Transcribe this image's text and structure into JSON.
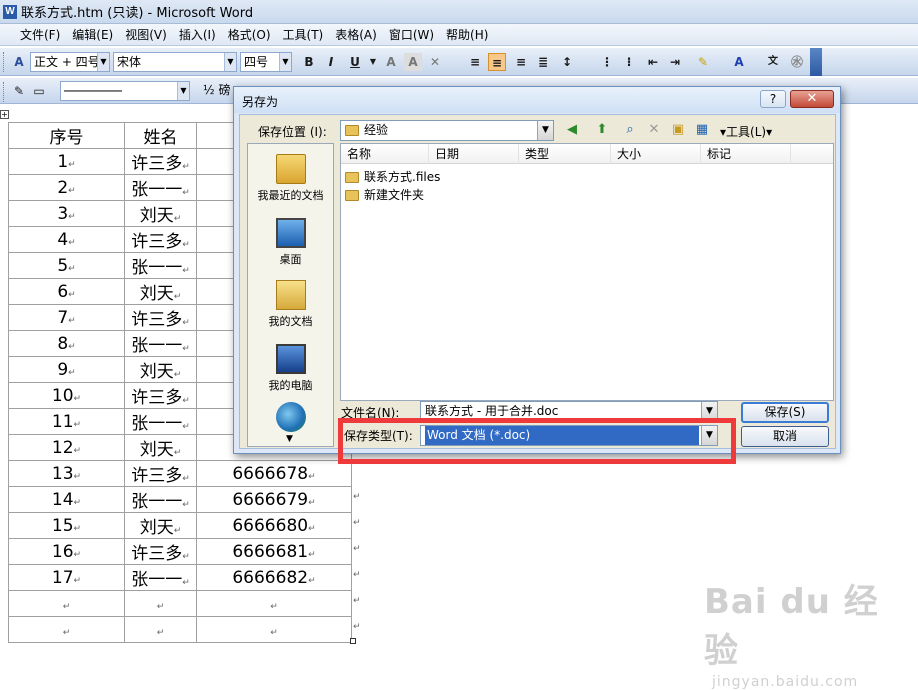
{
  "window": {
    "title": "联系方式.htm (只读) - Microsoft Word",
    "app_icon_letter": "W"
  },
  "menu": [
    "文件(F)",
    "编辑(E)",
    "视图(V)",
    "插入(I)",
    "格式(O)",
    "工具(T)",
    "表格(A)",
    "窗口(W)",
    "帮助(H)"
  ],
  "toolbar": {
    "style_combo": "正文 + 四号",
    "font_combo": "宋体",
    "size_combo": "四号",
    "bold": "B",
    "italic": "I",
    "underline": "U",
    "line_style": "────────",
    "line_weight": "½ 磅"
  },
  "table": {
    "headers": [
      "序号",
      "姓名",
      ""
    ],
    "rows": [
      [
        "1",
        "许三多",
        ""
      ],
      [
        "2",
        "张一一",
        ""
      ],
      [
        "3",
        "刘天",
        ""
      ],
      [
        "4",
        "许三多",
        ""
      ],
      [
        "5",
        "张一一",
        ""
      ],
      [
        "6",
        "刘天",
        ""
      ],
      [
        "7",
        "许三多",
        ""
      ],
      [
        "8",
        "张一一",
        ""
      ],
      [
        "9",
        "刘天",
        ""
      ],
      [
        "10",
        "许三多",
        ""
      ],
      [
        "11",
        "张一一",
        ""
      ],
      [
        "12",
        "刘天",
        ""
      ],
      [
        "13",
        "许三多",
        "6666678"
      ],
      [
        "14",
        "张一一",
        "6666679"
      ],
      [
        "15",
        "刘天",
        "6666680"
      ],
      [
        "16",
        "许三多",
        "6666681"
      ],
      [
        "17",
        "张一一",
        "6666682"
      ],
      [
        "",
        "",
        ""
      ],
      [
        "",
        "",
        ""
      ]
    ],
    "para_mark": "↵"
  },
  "dialog": {
    "title": "另存为",
    "help": "?",
    "close": "✕",
    "save_in_label": "保存位置 (I):",
    "save_in_value": "经验",
    "tools_label": "工具(L)",
    "places": [
      "我最近的文档",
      "桌面",
      "我的文档",
      "我的电脑"
    ],
    "columns": [
      "名称",
      "日期",
      "类型",
      "大小",
      "标记"
    ],
    "files": [
      "联系方式.files",
      "新建文件夹"
    ],
    "filename_label": "文件名(N):",
    "filename_value": "联系方式 - 用于合并.doc",
    "filetype_label": "保存类型(T):",
    "filetype_value": "Word 文档 (*.doc)",
    "save_button": "保存(S)",
    "cancel_button": "取消"
  },
  "watermark": {
    "logo": "Bai du 经验",
    "url": "jingyan.baidu.com"
  },
  "colors": {
    "highlight_box": "#ee3a3a",
    "selection": "#316ac5"
  }
}
